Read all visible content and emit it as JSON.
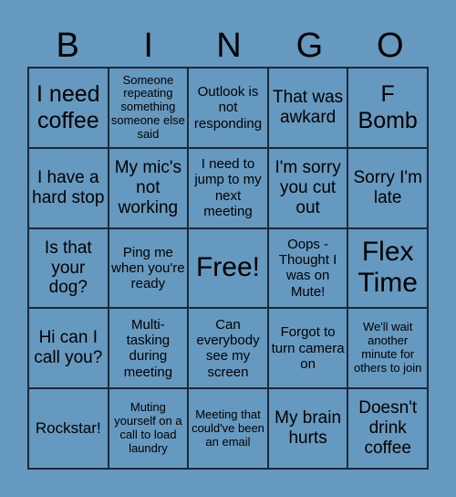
{
  "header": {
    "letters": [
      "B",
      "I",
      "N",
      "G",
      "O"
    ]
  },
  "colors": {
    "background": "#6699bf",
    "border": "#1a2a3a"
  },
  "cells": [
    [
      "I need coffee",
      "Someone repeating something someone else said",
      "Outlook is not responding",
      "That was awkard",
      "F Bomb"
    ],
    [
      "I have a hard stop",
      "My mic's not working",
      "I need to jump to my next meeting",
      "I'm sorry you cut out",
      "Sorry I'm late"
    ],
    [
      "Is that your dog?",
      "Ping me when you're ready",
      "Free!",
      "Oops - Thought I was on Mute!",
      "Flex Time"
    ],
    [
      "Hi can I call you?",
      "Multi-tasking during meeting",
      "Can everybody see my screen",
      "Forgot to turn camera on",
      "We'll wait another minute for others to join"
    ],
    [
      "Rockstar!",
      "Muting yourself on a call to load laundry",
      "Meeting that could've been an email",
      "My brain hurts",
      "Doesn't drink coffee"
    ]
  ]
}
